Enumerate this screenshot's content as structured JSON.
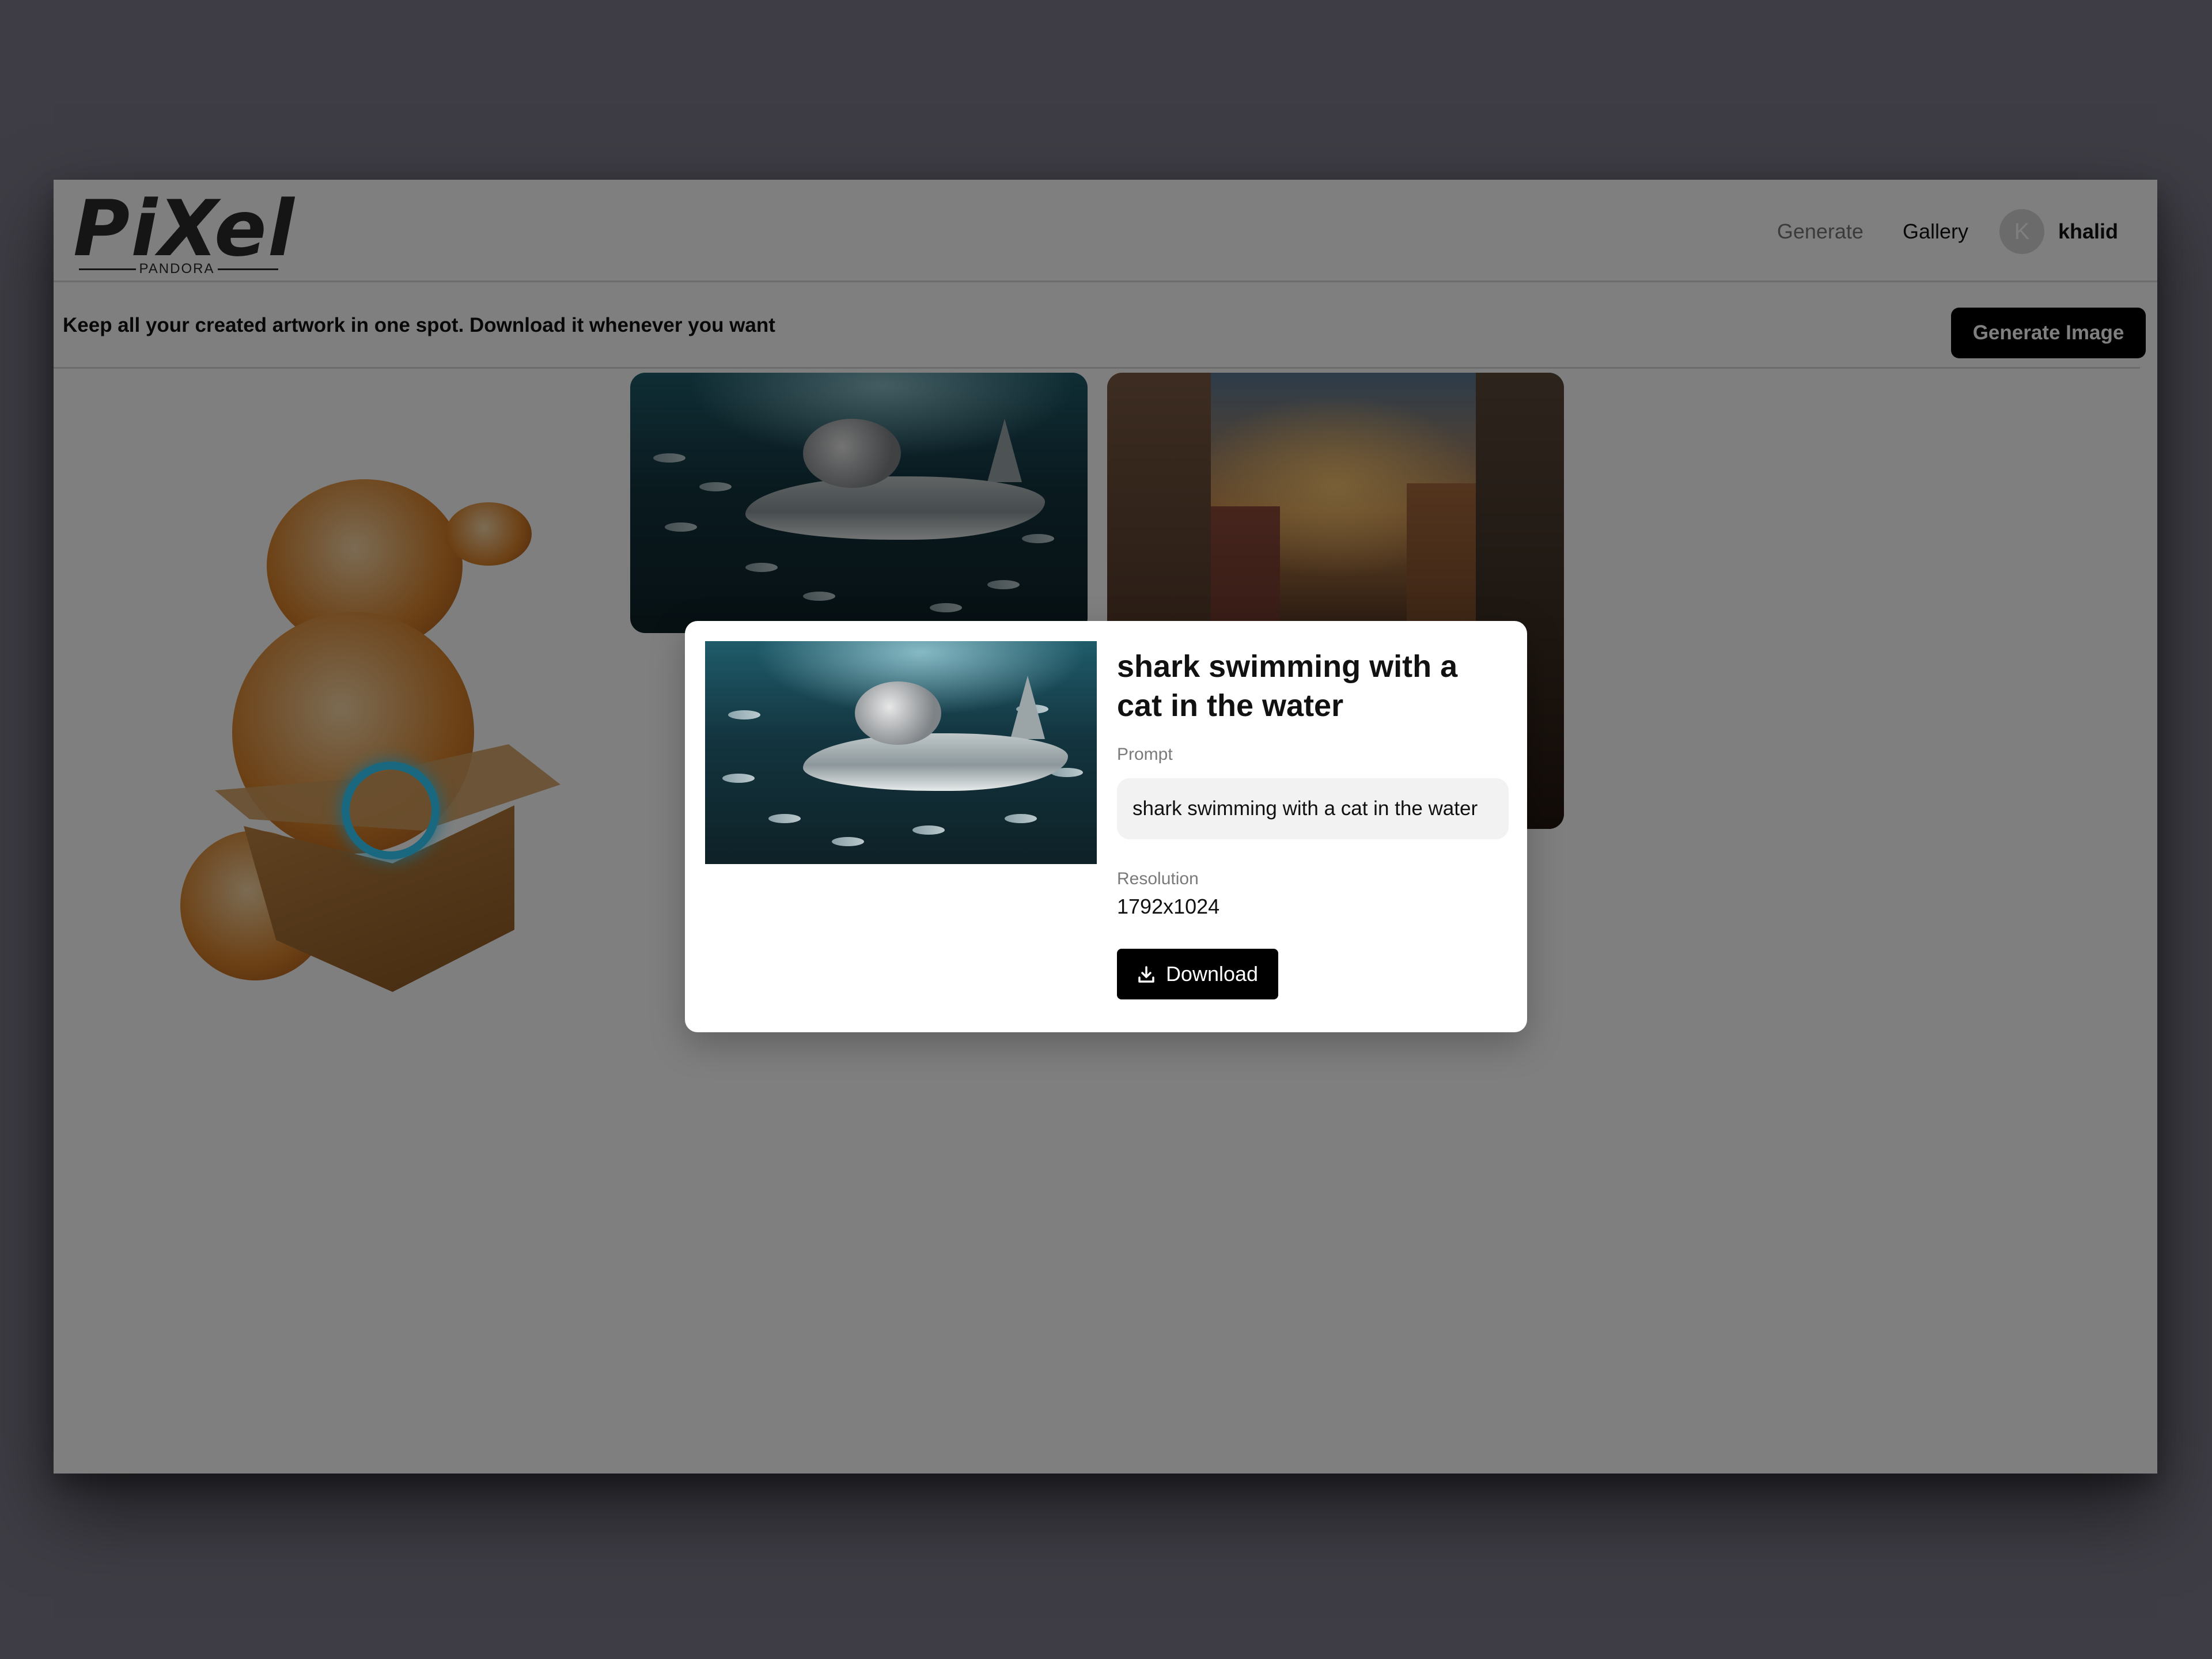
{
  "header": {
    "logo_text": "PiXel",
    "logo_subtext": "PANDORA",
    "nav": [
      {
        "label": "Generate"
      },
      {
        "label": "Gallery"
      }
    ],
    "user": {
      "initial": "K",
      "name": "khalid"
    }
  },
  "subheader": {
    "tagline": "Keep all your created artwork in one spot. Download it whenever you want",
    "generate_button": "Generate Image"
  },
  "modal": {
    "title": "shark swimming with a cat in the water",
    "prompt_label": "Prompt",
    "prompt_value": "shark swimming with a cat in the water",
    "resolution_label": "Resolution",
    "resolution_value": "1792x1024",
    "download_label": "Download",
    "download_icon": "download-icon"
  },
  "gallery": {
    "images": [
      {
        "subject": "cat with box"
      },
      {
        "subject": "shark with cat"
      },
      {
        "subject": "old town street at sunset"
      }
    ]
  },
  "colors": {
    "backdrop": "#3e3d45",
    "primary_button": "#000000",
    "overlay": "rgba(0,0,0,0.5)"
  }
}
